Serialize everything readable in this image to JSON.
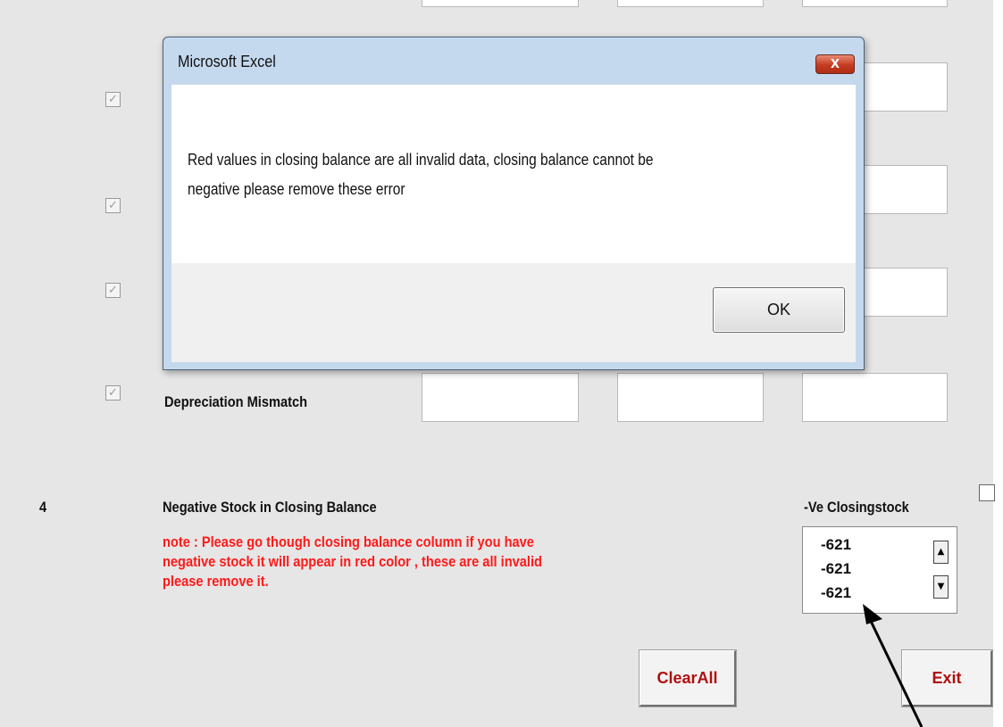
{
  "form": {
    "rows": [
      {
        "label": "Depreciation Mismatch",
        "checked": true
      }
    ],
    "section4": {
      "number": "4",
      "title": "Negative Stock in Closing Balance",
      "note_lines": [
        "note : Please go though closing balance column if you have",
        "negative stock it will appear in red color , these are all invalid",
        "please remove it."
      ]
    },
    "negative_list": {
      "label": "-Ve Closingstock",
      "items": [
        "-621",
        "-621",
        "-621"
      ]
    },
    "buttons": {
      "clear_all": "ClearAll",
      "exit": "Exit"
    },
    "colors": {
      "note_red": "#ff1a1a",
      "button_text": "#b01010",
      "form_background": "#e6e6e6"
    }
  },
  "dialog": {
    "title": "Microsoft Excel",
    "close_glyph": "X",
    "message_lines": [
      "Red values in closing balance are all invalid data, closing balance cannot be",
      "negative please remove these error"
    ],
    "ok_label": "OK"
  },
  "icons": {
    "checkbox": "checkmark-icon",
    "scroll_up": "triangle-up-icon",
    "scroll_down": "triangle-down-icon",
    "close": "close-icon",
    "pointer": "arrow-icon"
  }
}
